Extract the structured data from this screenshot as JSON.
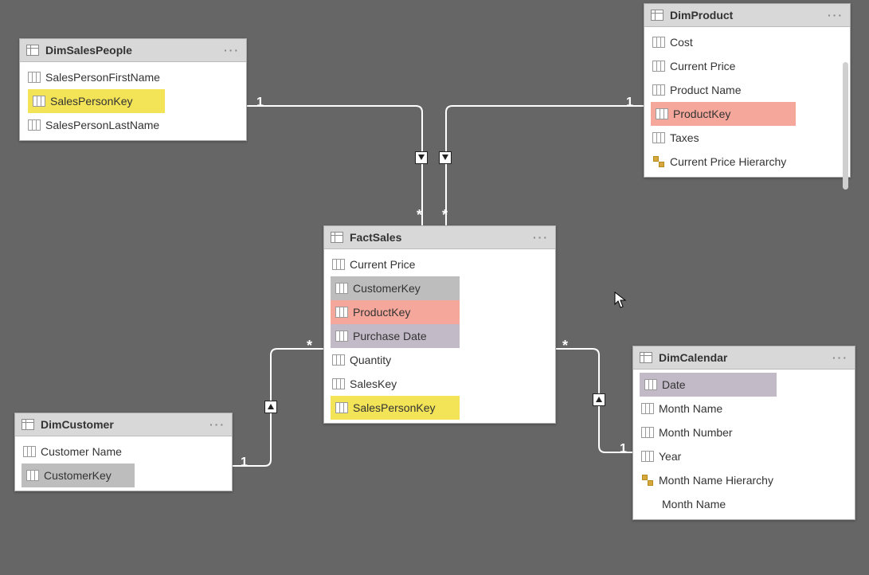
{
  "tables": {
    "dimSalesPeople": {
      "title": "DimSalesPeople",
      "fields": {
        "f1": "SalesPersonFirstName",
        "f2": "SalesPersonKey",
        "f3": "SalesPersonLastName"
      }
    },
    "dimProduct": {
      "title": "DimProduct",
      "fields": {
        "f1": "Cost",
        "f2": "Current Price",
        "f3": "Product Name",
        "f4": "ProductKey",
        "f5": "Taxes",
        "h1": "Current Price Hierarchy"
      }
    },
    "factSales": {
      "title": "FactSales",
      "fields": {
        "f1": "Current Price",
        "f2": "CustomerKey",
        "f3": "ProductKey",
        "f4": "Purchase Date",
        "f5": "Quantity",
        "f6": "SalesKey",
        "f7": "SalesPersonKey"
      }
    },
    "dimCustomer": {
      "title": "DimCustomer",
      "fields": {
        "f1": "Customer Name",
        "f2": "CustomerKey"
      }
    },
    "dimCalendar": {
      "title": "DimCalendar",
      "fields": {
        "f1": "Date",
        "f2": "Month Name",
        "f3": "Month Number",
        "f4": "Year",
        "h1": "Month Name Hierarchy",
        "h1l1": "Month Name"
      }
    }
  },
  "cardinality": {
    "one": "1",
    "many": "*"
  },
  "menu": "···"
}
